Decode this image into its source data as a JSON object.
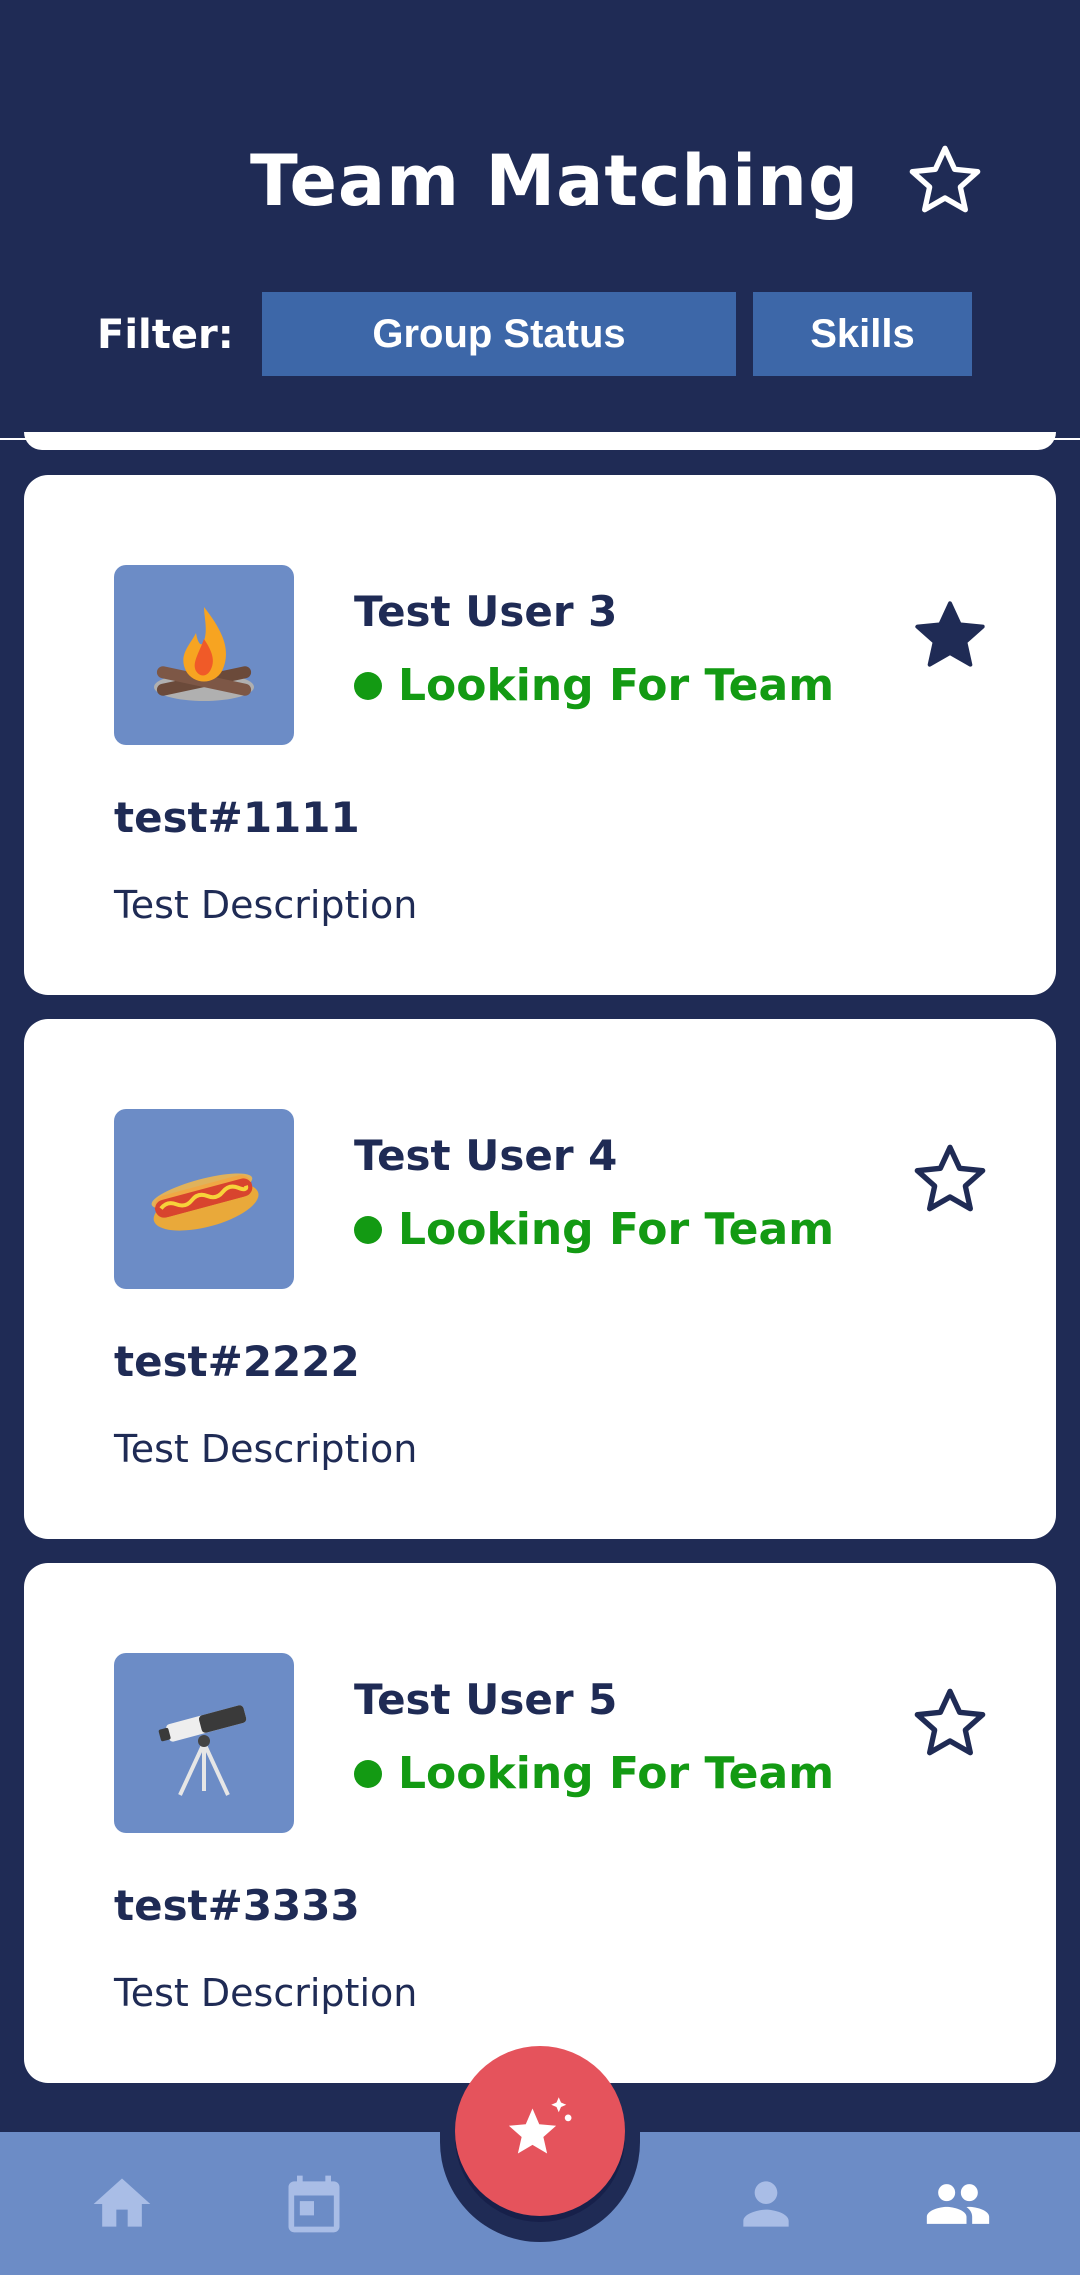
{
  "header": {
    "title": "Team Matching",
    "star_icon": "star-outline-icon"
  },
  "filter": {
    "label": "Filter:",
    "buttons": [
      "Group Status",
      "Skills"
    ]
  },
  "cards": [
    {
      "name": "Test User 3",
      "status": "Looking For Team",
      "tag": "test#1111",
      "description": "Test Description",
      "avatar": "campfire-icon",
      "favorited": true
    },
    {
      "name": "Test User 4",
      "status": "Looking For Team",
      "tag": "test#2222",
      "description": "Test Description",
      "avatar": "hotdog-icon",
      "favorited": false
    },
    {
      "name": "Test User 5",
      "status": "Looking For Team",
      "tag": "test#3333",
      "description": "Test Description",
      "avatar": "telescope-icon",
      "favorited": false
    }
  ],
  "nav": {
    "items": [
      "home-icon",
      "calendar-icon",
      "match-fab-icon",
      "profile-icon",
      "team-icon"
    ]
  },
  "colors": {
    "background": "#1f2b55",
    "accent": "#3d67a8",
    "nav": "#6c8cc6",
    "status": "#139a13",
    "fab": "#e5535c"
  }
}
